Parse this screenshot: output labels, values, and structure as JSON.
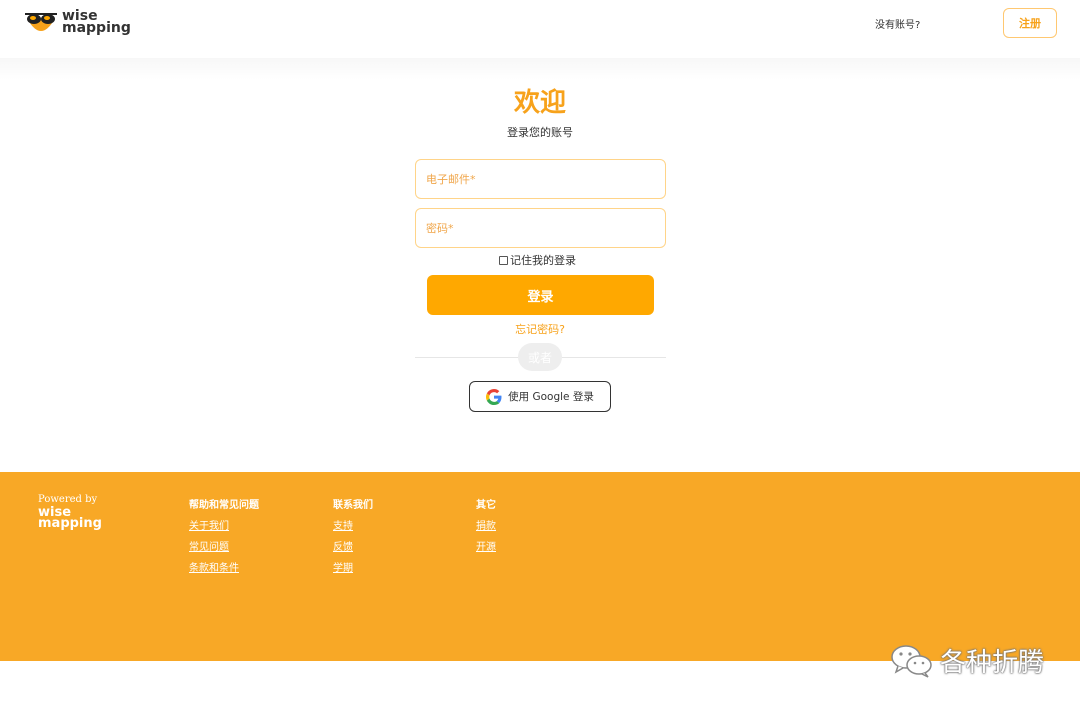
{
  "header": {
    "logo": {
      "word1": "wise",
      "word2": "mapping"
    },
    "no_account_text": "没有账号?",
    "signup_label": "注册"
  },
  "login": {
    "title": "欢迎",
    "subtitle": "登录您的账号",
    "email_placeholder": "电子邮件*",
    "password_placeholder": "密码*",
    "remember_label": "记住我的登录",
    "submit_label": "登录",
    "forgot_label": "忘记密码?",
    "or_label": "或者",
    "google_label": "使用 Google 登录"
  },
  "footer": {
    "powered_by": "Powered by",
    "brand_word1": "wise",
    "brand_word2": "mapping",
    "columns": [
      {
        "title": "帮助和常见问题",
        "links": [
          "关于我们",
          "常见问题",
          "条款和条件"
        ]
      },
      {
        "title": "联系我们",
        "links": [
          "支持",
          "反馈",
          "学期"
        ]
      },
      {
        "title": "其它",
        "links": [
          "捐款",
          "开源"
        ]
      }
    ]
  },
  "watermark": {
    "text": "各种折腾",
    "icon": "wechat-icon"
  },
  "colors": {
    "accent": "#f7a21b",
    "button": "#ffa800",
    "footer_bg": "#f8a826",
    "input_border": "#ffd489"
  }
}
